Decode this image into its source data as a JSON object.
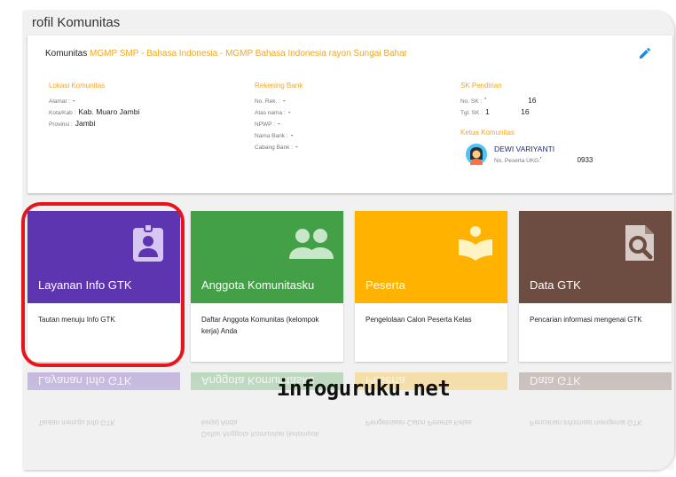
{
  "page": {
    "title": "rofil Komunitas"
  },
  "profile": {
    "komunitas_label": "Komunitas",
    "komunitas_name": "MGMP SMP - Bahasa Indonesia - MGMP Bahasa Indonesia rayon Sungai Bahar",
    "edit_icon": "pencil-icon",
    "lokasi": {
      "title": "Lokasi Komunitas",
      "rows": [
        {
          "label": "Alamat :",
          "value": "-"
        },
        {
          "label": "Kota/Kab :",
          "value": "Kab. Muaro Jambi"
        },
        {
          "label": "Provinsi :",
          "value": "Jambi"
        }
      ]
    },
    "rekening": {
      "title": "Rekening Bank",
      "rows": [
        {
          "label": "No. Rek. :",
          "value": "-"
        },
        {
          "label": "Atas nama :",
          "value": "-"
        },
        {
          "label": "NPWP :",
          "value": "-"
        },
        {
          "label": "Nama Bank :",
          "value": "-"
        },
        {
          "label": "Cabang Bank :",
          "value": "-"
        }
      ]
    },
    "sk": {
      "title": "SK Pendirian",
      "rows": [
        {
          "label": "No. SK :",
          "value": "'                    16"
        },
        {
          "label": "Tgl. SK :",
          "value": "1               16"
        }
      ]
    },
    "ketua": {
      "title": "Ketua Komunitas",
      "name": "DEWI VARIYANTI",
      "peserta_label": "No. Peserta UKG:",
      "peserta_value": "'                  0933"
    }
  },
  "tiles": [
    {
      "title": "Layanan Info GTK",
      "desc": "Tautan menuju Info GTK",
      "color": "#5e35b1",
      "icon": "id-badge-icon"
    },
    {
      "title": "Anggota Komunitasku",
      "desc": "Daftar Anggota Komunitas (kelompok kerja) Anda",
      "color": "#43a047",
      "icon": "people-icon"
    },
    {
      "title": "Peserta",
      "desc": "Pengelolaan Calon Peserta Kelas",
      "color": "#ffb300",
      "icon": "book-reader-icon"
    },
    {
      "title": "Data GTK",
      "desc": "Pencarian informasi mengenai GTK",
      "color": "#6d4c41",
      "icon": "file-search-icon"
    }
  ],
  "watermark": "infoguruku.net"
}
